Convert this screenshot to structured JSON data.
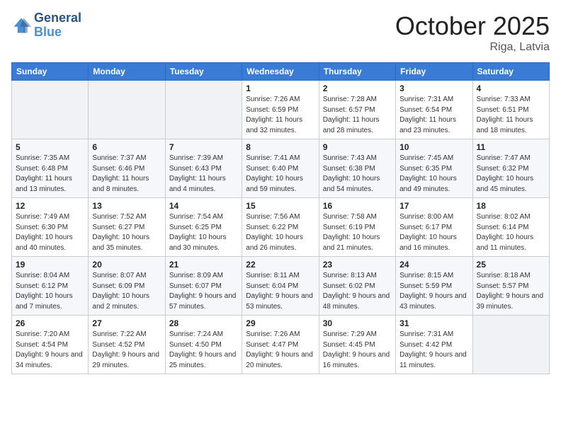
{
  "header": {
    "logo_line1": "General",
    "logo_line2": "Blue",
    "month": "October 2025",
    "location": "Riga, Latvia"
  },
  "weekdays": [
    "Sunday",
    "Monday",
    "Tuesday",
    "Wednesday",
    "Thursday",
    "Friday",
    "Saturday"
  ],
  "weeks": [
    [
      {
        "day": "",
        "sunrise": "",
        "sunset": "",
        "daylight": ""
      },
      {
        "day": "",
        "sunrise": "",
        "sunset": "",
        "daylight": ""
      },
      {
        "day": "",
        "sunrise": "",
        "sunset": "",
        "daylight": ""
      },
      {
        "day": "1",
        "sunrise": "Sunrise: 7:26 AM",
        "sunset": "Sunset: 6:59 PM",
        "daylight": "Daylight: 11 hours and 32 minutes."
      },
      {
        "day": "2",
        "sunrise": "Sunrise: 7:28 AM",
        "sunset": "Sunset: 6:57 PM",
        "daylight": "Daylight: 11 hours and 28 minutes."
      },
      {
        "day": "3",
        "sunrise": "Sunrise: 7:31 AM",
        "sunset": "Sunset: 6:54 PM",
        "daylight": "Daylight: 11 hours and 23 minutes."
      },
      {
        "day": "4",
        "sunrise": "Sunrise: 7:33 AM",
        "sunset": "Sunset: 6:51 PM",
        "daylight": "Daylight: 11 hours and 18 minutes."
      }
    ],
    [
      {
        "day": "5",
        "sunrise": "Sunrise: 7:35 AM",
        "sunset": "Sunset: 6:48 PM",
        "daylight": "Daylight: 11 hours and 13 minutes."
      },
      {
        "day": "6",
        "sunrise": "Sunrise: 7:37 AM",
        "sunset": "Sunset: 6:46 PM",
        "daylight": "Daylight: 11 hours and 8 minutes."
      },
      {
        "day": "7",
        "sunrise": "Sunrise: 7:39 AM",
        "sunset": "Sunset: 6:43 PM",
        "daylight": "Daylight: 11 hours and 4 minutes."
      },
      {
        "day": "8",
        "sunrise": "Sunrise: 7:41 AM",
        "sunset": "Sunset: 6:40 PM",
        "daylight": "Daylight: 10 hours and 59 minutes."
      },
      {
        "day": "9",
        "sunrise": "Sunrise: 7:43 AM",
        "sunset": "Sunset: 6:38 PM",
        "daylight": "Daylight: 10 hours and 54 minutes."
      },
      {
        "day": "10",
        "sunrise": "Sunrise: 7:45 AM",
        "sunset": "Sunset: 6:35 PM",
        "daylight": "Daylight: 10 hours and 49 minutes."
      },
      {
        "day": "11",
        "sunrise": "Sunrise: 7:47 AM",
        "sunset": "Sunset: 6:32 PM",
        "daylight": "Daylight: 10 hours and 45 minutes."
      }
    ],
    [
      {
        "day": "12",
        "sunrise": "Sunrise: 7:49 AM",
        "sunset": "Sunset: 6:30 PM",
        "daylight": "Daylight: 10 hours and 40 minutes."
      },
      {
        "day": "13",
        "sunrise": "Sunrise: 7:52 AM",
        "sunset": "Sunset: 6:27 PM",
        "daylight": "Daylight: 10 hours and 35 minutes."
      },
      {
        "day": "14",
        "sunrise": "Sunrise: 7:54 AM",
        "sunset": "Sunset: 6:25 PM",
        "daylight": "Daylight: 10 hours and 30 minutes."
      },
      {
        "day": "15",
        "sunrise": "Sunrise: 7:56 AM",
        "sunset": "Sunset: 6:22 PM",
        "daylight": "Daylight: 10 hours and 26 minutes."
      },
      {
        "day": "16",
        "sunrise": "Sunrise: 7:58 AM",
        "sunset": "Sunset: 6:19 PM",
        "daylight": "Daylight: 10 hours and 21 minutes."
      },
      {
        "day": "17",
        "sunrise": "Sunrise: 8:00 AM",
        "sunset": "Sunset: 6:17 PM",
        "daylight": "Daylight: 10 hours and 16 minutes."
      },
      {
        "day": "18",
        "sunrise": "Sunrise: 8:02 AM",
        "sunset": "Sunset: 6:14 PM",
        "daylight": "Daylight: 10 hours and 11 minutes."
      }
    ],
    [
      {
        "day": "19",
        "sunrise": "Sunrise: 8:04 AM",
        "sunset": "Sunset: 6:12 PM",
        "daylight": "Daylight: 10 hours and 7 minutes."
      },
      {
        "day": "20",
        "sunrise": "Sunrise: 8:07 AM",
        "sunset": "Sunset: 6:09 PM",
        "daylight": "Daylight: 10 hours and 2 minutes."
      },
      {
        "day": "21",
        "sunrise": "Sunrise: 8:09 AM",
        "sunset": "Sunset: 6:07 PM",
        "daylight": "Daylight: 9 hours and 57 minutes."
      },
      {
        "day": "22",
        "sunrise": "Sunrise: 8:11 AM",
        "sunset": "Sunset: 6:04 PM",
        "daylight": "Daylight: 9 hours and 53 minutes."
      },
      {
        "day": "23",
        "sunrise": "Sunrise: 8:13 AM",
        "sunset": "Sunset: 6:02 PM",
        "daylight": "Daylight: 9 hours and 48 minutes."
      },
      {
        "day": "24",
        "sunrise": "Sunrise: 8:15 AM",
        "sunset": "Sunset: 5:59 PM",
        "daylight": "Daylight: 9 hours and 43 minutes."
      },
      {
        "day": "25",
        "sunrise": "Sunrise: 8:18 AM",
        "sunset": "Sunset: 5:57 PM",
        "daylight": "Daylight: 9 hours and 39 minutes."
      }
    ],
    [
      {
        "day": "26",
        "sunrise": "Sunrise: 7:20 AM",
        "sunset": "Sunset: 4:54 PM",
        "daylight": "Daylight: 9 hours and 34 minutes."
      },
      {
        "day": "27",
        "sunrise": "Sunrise: 7:22 AM",
        "sunset": "Sunset: 4:52 PM",
        "daylight": "Daylight: 9 hours and 29 minutes."
      },
      {
        "day": "28",
        "sunrise": "Sunrise: 7:24 AM",
        "sunset": "Sunset: 4:50 PM",
        "daylight": "Daylight: 9 hours and 25 minutes."
      },
      {
        "day": "29",
        "sunrise": "Sunrise: 7:26 AM",
        "sunset": "Sunset: 4:47 PM",
        "daylight": "Daylight: 9 hours and 20 minutes."
      },
      {
        "day": "30",
        "sunrise": "Sunrise: 7:29 AM",
        "sunset": "Sunset: 4:45 PM",
        "daylight": "Daylight: 9 hours and 16 minutes."
      },
      {
        "day": "31",
        "sunrise": "Sunrise: 7:31 AM",
        "sunset": "Sunset: 4:42 PM",
        "daylight": "Daylight: 9 hours and 11 minutes."
      },
      {
        "day": "",
        "sunrise": "",
        "sunset": "",
        "daylight": ""
      }
    ]
  ]
}
